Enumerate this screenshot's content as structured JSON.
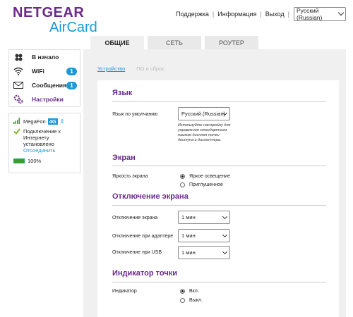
{
  "brand": {
    "name": "NETGEAR",
    "product": "AirCard",
    "purple": "#6b2a8c",
    "blue": "#1a9ad6"
  },
  "topnav": {
    "support": "Поддержка",
    "info": "Информация",
    "logout": "Выход",
    "language": "Русский (Russian)"
  },
  "tabs": [
    "ОБЩИЕ",
    "СЕТЬ",
    "РОУТЕР"
  ],
  "sidebar": {
    "items": [
      {
        "label": "В начало",
        "icon": "home-icon",
        "badge": ""
      },
      {
        "label": "WiFi",
        "icon": "wifi-icon",
        "badge": "1"
      },
      {
        "label": "Сообщения",
        "icon": "mail-icon",
        "badge": "1"
      },
      {
        "label": "Настройки",
        "icon": "gears-icon",
        "badge": ""
      }
    ]
  },
  "status": {
    "carrier": "MegaFon",
    "network": "4G",
    "connected_text": "Подключение к Интернету установлено",
    "disconnect": "Отсоединить",
    "battery": "100%"
  },
  "subtabs": {
    "device": "Устройство",
    "software": "ПО и сброс"
  },
  "sections": {
    "language": {
      "title": "Язык",
      "default_label": "Язык по умолчанию",
      "default_value": "Русский (Russian)",
      "note": "Используйте настройку для управления стандартным языком дисплея точки доступа и диспетчера."
    },
    "screen": {
      "title": "Экран",
      "brightness_label": "Яркость экрана",
      "options": [
        "Яркое освещение",
        "Приглушенное"
      ],
      "selected": 0
    },
    "screen_off": {
      "title": "Отключение экрана",
      "rows": [
        {
          "label": "Отключение экрана",
          "value": "1 мин"
        },
        {
          "label": "Отключение при адаптере",
          "value": "1 мин"
        },
        {
          "label": "Отключение при USB",
          "value": "1 мин"
        }
      ]
    },
    "indicator": {
      "title": "Индикатор точки",
      "label": "Индикатор",
      "options": [
        "Вкл.",
        "Выкл."
      ],
      "selected": 0
    }
  }
}
